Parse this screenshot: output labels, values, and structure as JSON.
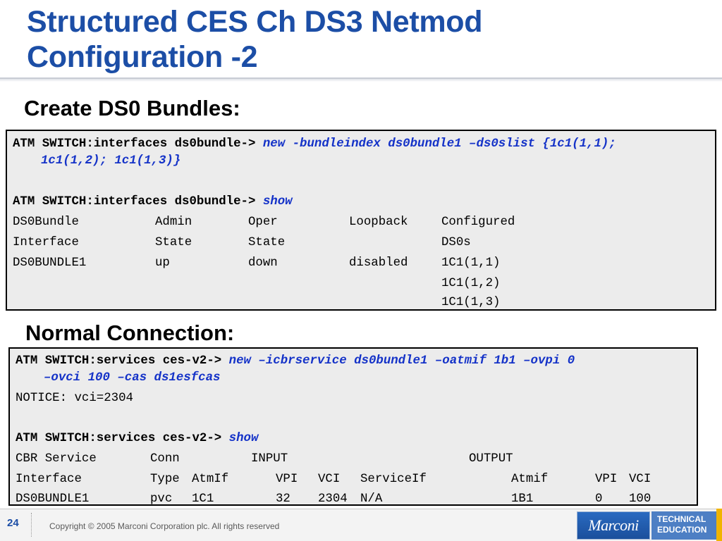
{
  "title": {
    "line1": "Structured CES Ch DS3 Netmod",
    "line2": "Configuration -2"
  },
  "section1": {
    "heading": "Create DS0 Bundles:"
  },
  "term1": {
    "prompt1": "ATM SWITCH:interfaces ds0bundle->",
    "cmd1a": "new -bundleindex ds0bundle1 –ds0slist {1c1(1,1);",
    "cmd1b": "1c1(1,2); 1c1(1,3)}",
    "prompt2": "ATM SWITCH:interfaces ds0bundle->",
    "cmd2": "show",
    "headers1": [
      "DS0Bundle",
      "Admin",
      "Oper",
      "Loopback",
      "Configured"
    ],
    "headers2": [
      "Interface",
      "State",
      "State",
      "",
      "DS0s"
    ],
    "row": [
      "DS0BUNDLE1",
      "up",
      "down",
      "disabled",
      "1C1(1,1)"
    ],
    "extra": [
      "1C1(1,2)",
      "1C1(1,3)"
    ]
  },
  "section2": {
    "heading": "Normal Connection:"
  },
  "term2": {
    "prompt1": "ATM SWITCH:services ces-v2->",
    "cmd1a": "new –icbrservice ds0bundle1 –oatmif 1b1 –ovpi 0",
    "cmd1b": "–ovci 100 –cas ds1esfcas",
    "notice": "NOTICE: vci=2304",
    "prompt2": "ATM SWITCH:services ces-v2->",
    "cmd2": "show",
    "headers1": [
      "CBR Service",
      "Conn",
      "INPUT",
      "OUTPUT"
    ],
    "headers2": [
      "Interface",
      "Type",
      "AtmIf",
      "VPI",
      "VCI",
      "ServiceIf",
      "Atmif",
      "VPI",
      "VCI"
    ],
    "row": [
      "DS0BUNDLE1",
      "pvc",
      "1C1",
      "32",
      "2304",
      "N/A",
      "1B1",
      "0",
      "100"
    ]
  },
  "footer": {
    "page": "24",
    "copyright": "Copyright © 2005 Marconi Corporation plc. All rights reserved",
    "logo": "Marconi",
    "edu1": "TECHNICAL",
    "edu2": "EDUCATION"
  },
  "colors": {
    "title": "#1c4ea6",
    "command": "#1432c8",
    "terminal_bg": "#ececec",
    "accent_edge": "#f0b400"
  }
}
